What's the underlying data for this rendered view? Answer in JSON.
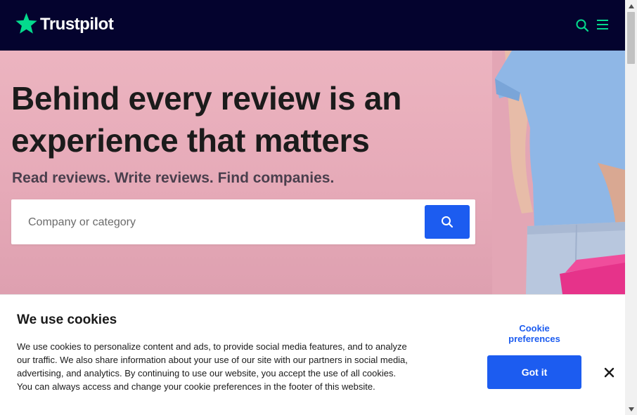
{
  "header": {
    "brand": "Trustpilot",
    "logo_icon": "star-logo-icon",
    "search_icon": "search-icon",
    "menu_icon": "hamburger-menu-icon",
    "accent_color": "#04da8d",
    "background_color": "#04032e"
  },
  "hero": {
    "headline_line1": "Behind every review is an",
    "headline_line2": "experience that matters",
    "subheadline": "Read reviews. Write reviews. Find companies.",
    "background_color": "#e9b0bc"
  },
  "search": {
    "placeholder": "Company or category",
    "value": "",
    "button_icon": "search-icon",
    "button_color": "#1c5cf0"
  },
  "cookie_banner": {
    "title": "We use cookies",
    "body": "We use cookies to personalize content and ads, to provide social media features, and to analyze our traffic. We also share information about your use of our site with our partners in social media, advertising, and analytics. By continuing to use our website, you accept the use of all cookies. You can always access and change your cookie preferences in the footer of this website.",
    "preferences_line1": "Cookie",
    "preferences_line2": "preferences",
    "accept_label": "Got it",
    "close_icon": "close-icon"
  }
}
